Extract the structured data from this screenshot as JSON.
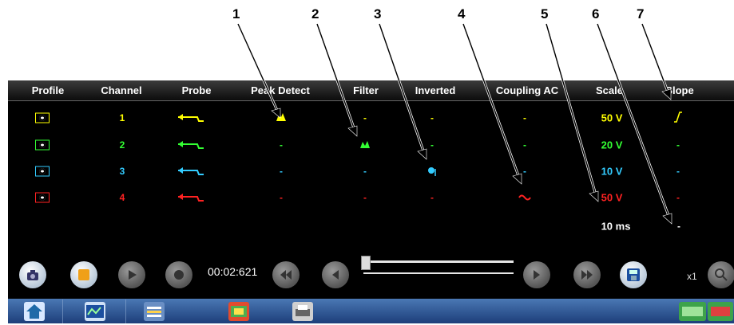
{
  "callouts": [
    "1",
    "2",
    "3",
    "4",
    "5",
    "6",
    "7"
  ],
  "columns": [
    "Profile",
    "Channel",
    "Probe",
    "Peak Detect",
    "Filter",
    "Inverted",
    "Coupling AC",
    "Scale",
    "Slope"
  ],
  "channels": [
    {
      "number": "1",
      "color": "#ffff00",
      "peak": "peak-detect-on-icon",
      "filter": "-",
      "inverted": "-",
      "coupling": "-",
      "scale": "50 V",
      "slope": "rising-slope-icon"
    },
    {
      "number": "2",
      "color": "#33ff33",
      "peak": "-",
      "filter": "filter-on-icon",
      "inverted": "-",
      "coupling": "-",
      "scale": "20 V",
      "slope": "-"
    },
    {
      "number": "3",
      "color": "#33ccff",
      "peak": "-",
      "filter": "-",
      "inverted": "inverted-on-icon",
      "coupling": "-",
      "scale": "10 V",
      "slope": "-"
    },
    {
      "number": "4",
      "color": "#ff2222",
      "peak": "-",
      "filter": "-",
      "inverted": "-",
      "coupling": "coupling-ac-icon",
      "scale": "50 V",
      "slope": "-"
    }
  ],
  "sweep": {
    "time_scale": "10 ms",
    "slope": "-",
    "color": "#ffffff"
  },
  "controls": {
    "elapsed": "00:02:621",
    "zoom": "x1"
  },
  "icons": [
    "camera-icon",
    "stop-icon",
    "play-icon",
    "record-icon",
    "skip-back-icon",
    "step-back-icon",
    "step-forward-icon",
    "skip-forward-icon",
    "save-icon",
    "zoom-icon"
  ],
  "taskbar": [
    "home-icon",
    "scope-icon",
    "tools-icon",
    "meter-icon",
    "print-icon",
    "network-icon"
  ]
}
